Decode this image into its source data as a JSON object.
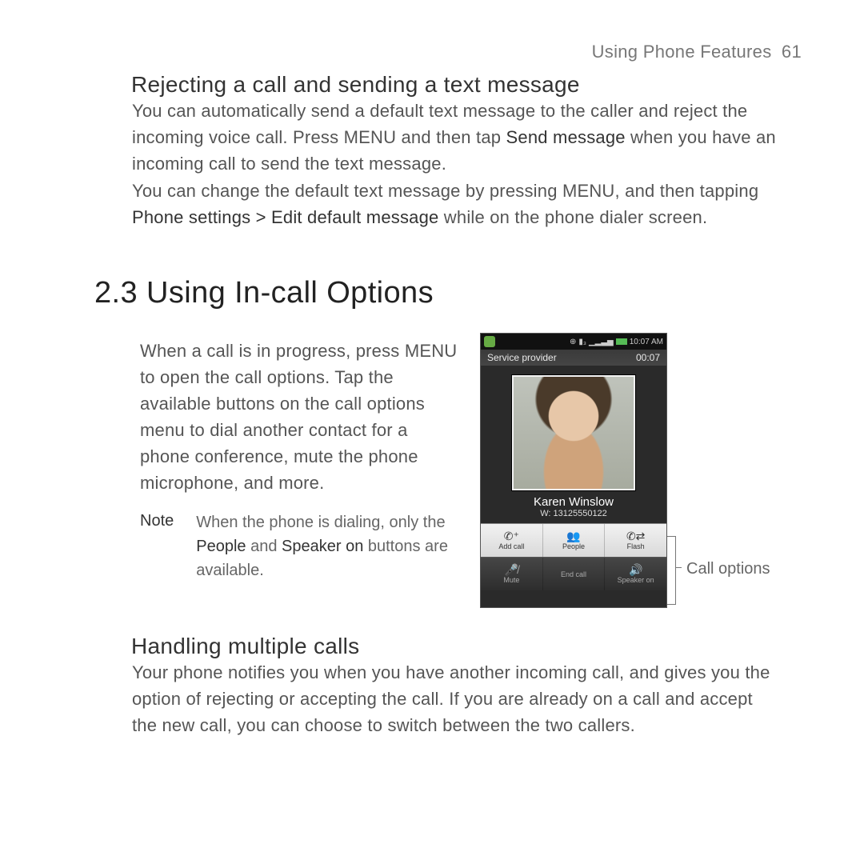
{
  "running_head": {
    "title": "Using Phone Features",
    "page": "61"
  },
  "section1": {
    "title": "Rejecting a call and sending a text message",
    "p1_a": "You can automatically send a default text message to the caller and reject the incoming voice call. Press MENU and then tap ",
    "p1_b": "Send message",
    "p1_c": " when you have an incoming call to send the text message.",
    "p2_a": "You can change the default text message by pressing MENU, and then tapping ",
    "p2_b": "Phone settings > Edit default message",
    "p2_c": " while on the phone dialer screen."
  },
  "h2": "2.3  Using In-call Options",
  "p3": "When a call is in progress, press MENU to open the call options. Tap the available buttons on the call options menu to dial another contact for a phone conference, mute the phone microphone, and more.",
  "note": {
    "label": "Note",
    "a": "When the phone is dialing, only the ",
    "b": "People",
    "c": " and ",
    "d": "Speaker on",
    "e": " buttons are available."
  },
  "phone": {
    "time": "10:07 AM",
    "provider": "Service provider",
    "elapsed": "00:07",
    "caller_name": "Karen Winslow",
    "caller_number": "W: 13125550122",
    "opts_top": [
      "Add call",
      "People",
      "Flash"
    ],
    "opts_bot": [
      "Mute",
      "End call",
      "Speaker on"
    ]
  },
  "call_options_label": "Call options",
  "section3": {
    "title": "Handling multiple calls",
    "p": "Your phone notifies you when you have another incoming call, and gives you the option of rejecting or accepting the call. If you are already on a call and accept the new call, you can choose to switch between the two callers."
  }
}
